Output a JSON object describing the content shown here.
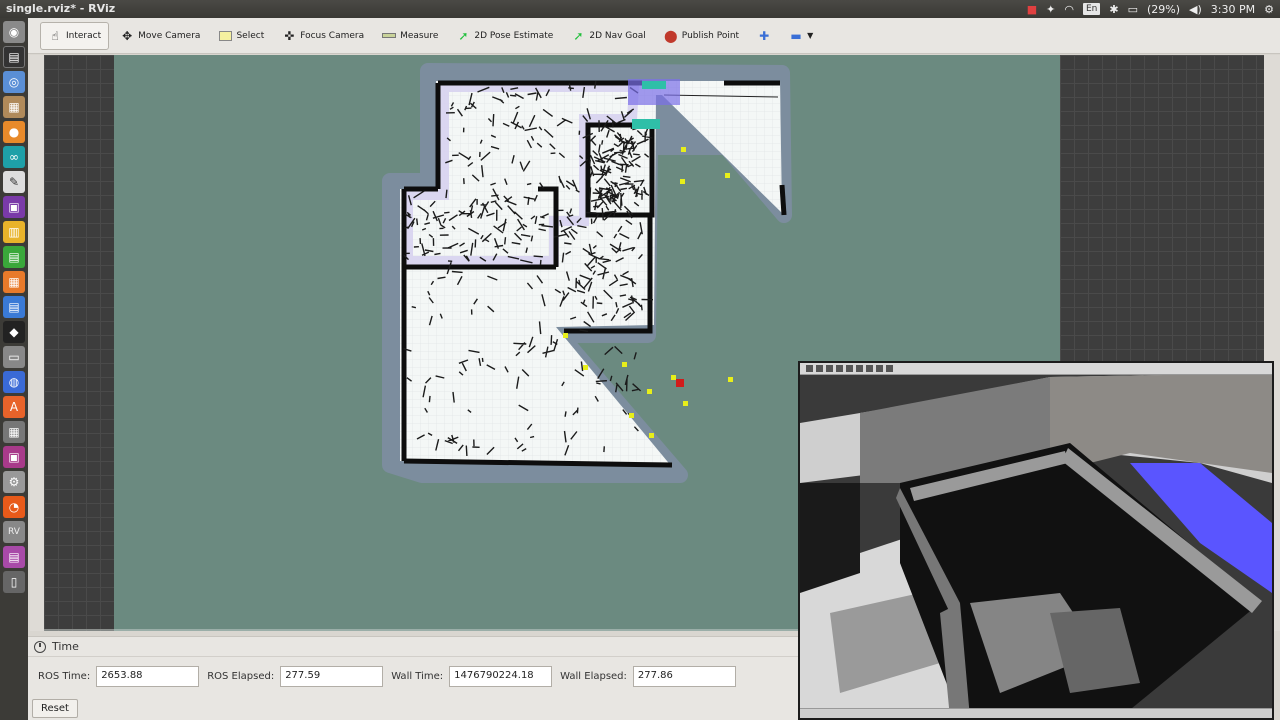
{
  "window": {
    "title": "single.rviz* - RViz"
  },
  "tray": {
    "keyboard": "En",
    "battery": "(29%)",
    "clock": "3:30 PM"
  },
  "toolbar": {
    "interact": "Interact",
    "move_camera": "Move Camera",
    "select": "Select",
    "focus_camera": "Focus Camera",
    "measure": "Measure",
    "pose_estimate": "2D Pose Estimate",
    "nav_goal": "2D Nav Goal",
    "publish_point": "Publish Point"
  },
  "time_panel": {
    "title": "Time",
    "ros_time_label": "ROS Time:",
    "ros_time": "2653.88",
    "ros_elapsed_label": "ROS Elapsed:",
    "ros_elapsed": "277.59",
    "wall_time_label": "Wall Time:",
    "wall_time": "1476790224.18",
    "wall_elapsed_label": "Wall Elapsed:",
    "wall_elapsed": "277.86",
    "reset": "Reset"
  },
  "colors": {
    "map_bg": "#6b8a80",
    "free_space": "#f4f7f6",
    "wall": "#0d0d0d",
    "marker_yellow": "#e8ef1a",
    "robot_red": "#d11b1b",
    "goal_blue": "#5a55ff"
  },
  "icons": [
    "hand-icon",
    "move-camera-icon",
    "select-icon",
    "focus-camera-icon",
    "measure-icon",
    "pose-arrow-icon",
    "goal-arrow-icon",
    "map-pin-icon",
    "plus-icon",
    "minus-icon",
    "clock-icon"
  ]
}
